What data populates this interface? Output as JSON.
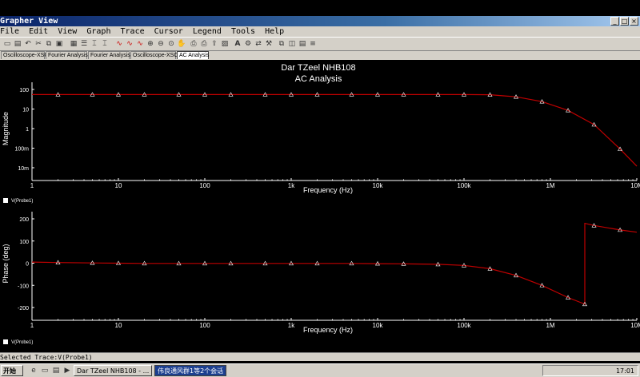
{
  "window": {
    "title": "Grapher View"
  },
  "menu": [
    "File",
    "Edit",
    "View",
    "Graph",
    "Trace",
    "Cursor",
    "Legend",
    "Tools",
    "Help"
  ],
  "tabs": [
    {
      "label": "Oscilloscope-XSC1"
    },
    {
      "label": "Fourier Analysis"
    },
    {
      "label": "Fourier Analysis"
    },
    {
      "label": "Oscilloscope-XSC1"
    },
    {
      "label": "AC Analysis",
      "active": true
    }
  ],
  "graph": {
    "title_line1": "Dar TZeel NHB108",
    "title_line2": "AC Analysis",
    "trace_color": "#c00000",
    "marker_color": "#ffffff"
  },
  "chart_data": [
    {
      "type": "line",
      "title": "Dar TZeel NHB108",
      "subtitle": "AC Analysis",
      "xlabel": "Frequency (Hz)",
      "ylabel": "Magnitude",
      "xscale": "log",
      "yscale": "log",
      "xlim": [
        1,
        10000000
      ],
      "ylim": [
        0.005,
        150
      ],
      "xticks": [
        "1",
        "10",
        "100",
        "1k",
        "10k",
        "100k",
        "1M",
        "10M"
      ],
      "yticks": [
        "10m",
        "100m",
        "1",
        "10",
        "100"
      ],
      "legend": "V(Probe1)",
      "series": [
        {
          "name": "V(Probe1)",
          "x": [
            1,
            2,
            5,
            10,
            20,
            50,
            100,
            200,
            500,
            1000,
            2000,
            5000,
            10000,
            20000,
            50000,
            100000,
            200000,
            400000,
            800000,
            1600000,
            3200000,
            6400000,
            10000000
          ],
          "y": [
            55,
            55,
            55,
            55,
            55,
            55,
            55,
            55,
            55,
            55,
            55,
            55,
            55,
            55,
            55,
            55,
            54,
            42,
            24,
            8.5,
            1.6,
            0.09,
            0.012
          ]
        }
      ]
    },
    {
      "type": "line",
      "xlabel": "Frequency (Hz)",
      "ylabel": "Phase (deg)",
      "xscale": "log",
      "xlim": [
        1,
        10000000
      ],
      "ylim": [
        -210,
        240
      ],
      "xticks": [
        "1",
        "10",
        "100",
        "1k",
        "10k",
        "100k",
        "1M",
        "10M"
      ],
      "yticks": [
        "-200",
        "-100",
        "0",
        "100",
        "200"
      ],
      "legend": "V(Probe1)",
      "series": [
        {
          "name": "V(Probe1)",
          "x": [
            1,
            2,
            5,
            10,
            20,
            50,
            100,
            200,
            500,
            1000,
            2000,
            5000,
            10000,
            20000,
            50000,
            100000,
            200000,
            400000,
            800000,
            1600000,
            2500000,
            2500001,
            3200000,
            6400000,
            10000000
          ],
          "y": [
            5,
            3,
            1,
            0,
            -1,
            -1,
            -1,
            -1,
            -1,
            -1,
            -1,
            -1,
            -2,
            -3,
            -5,
            -10,
            -25,
            -55,
            -100,
            -155,
            -185,
            180,
            170,
            150,
            140
          ]
        }
      ]
    }
  ],
  "status": {
    "selected_trace": "Selected Trace:V(Probe1)"
  },
  "taskbar": {
    "start": "开始",
    "tasks": [
      {
        "label": "Dar TZeel NHB108 - ..."
      },
      {
        "label": "伟良通风群1等2个会话",
        "active": true
      }
    ],
    "clock": "17:01"
  }
}
